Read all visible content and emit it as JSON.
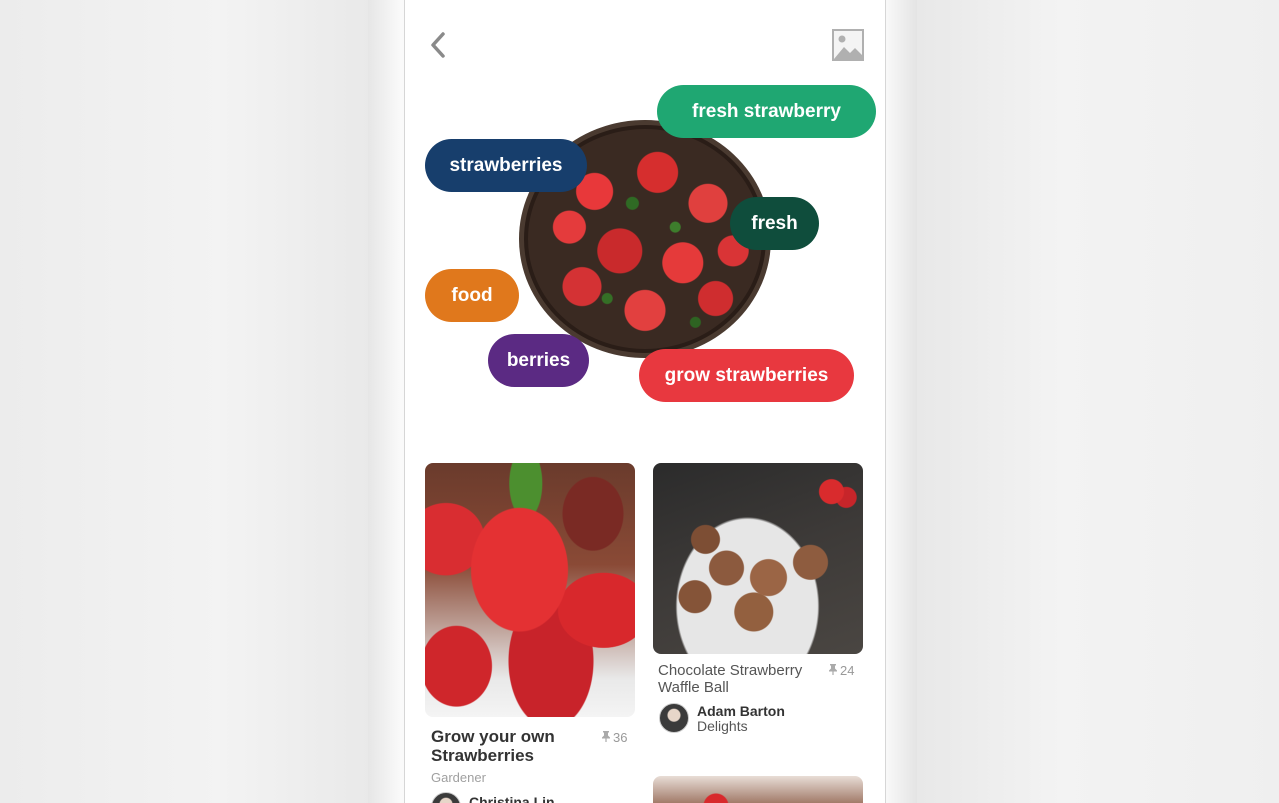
{
  "header": {
    "back_icon": "chevron-left-icon",
    "image_icon": "image-icon"
  },
  "tags": [
    {
      "label": "fresh strawberry",
      "color": "#1fa772"
    },
    {
      "label": "strawberries",
      "color": "#173e6c"
    },
    {
      "label": "fresh",
      "color": "#0f4d3c"
    },
    {
      "label": "food",
      "color": "#e0781c"
    },
    {
      "label": "berries",
      "color": "#5b2a83"
    },
    {
      "label": "grow strawberries",
      "color": "#e8383f"
    }
  ],
  "pins": [
    {
      "title": "Grow your own Strawberries",
      "saves": "36",
      "board": "Gardener",
      "author": "Christina Lin"
    },
    {
      "title": "Chocolate Strawberry Waffle Ball",
      "saves": "24",
      "author": "Adam Barton",
      "board": "Delights"
    }
  ]
}
